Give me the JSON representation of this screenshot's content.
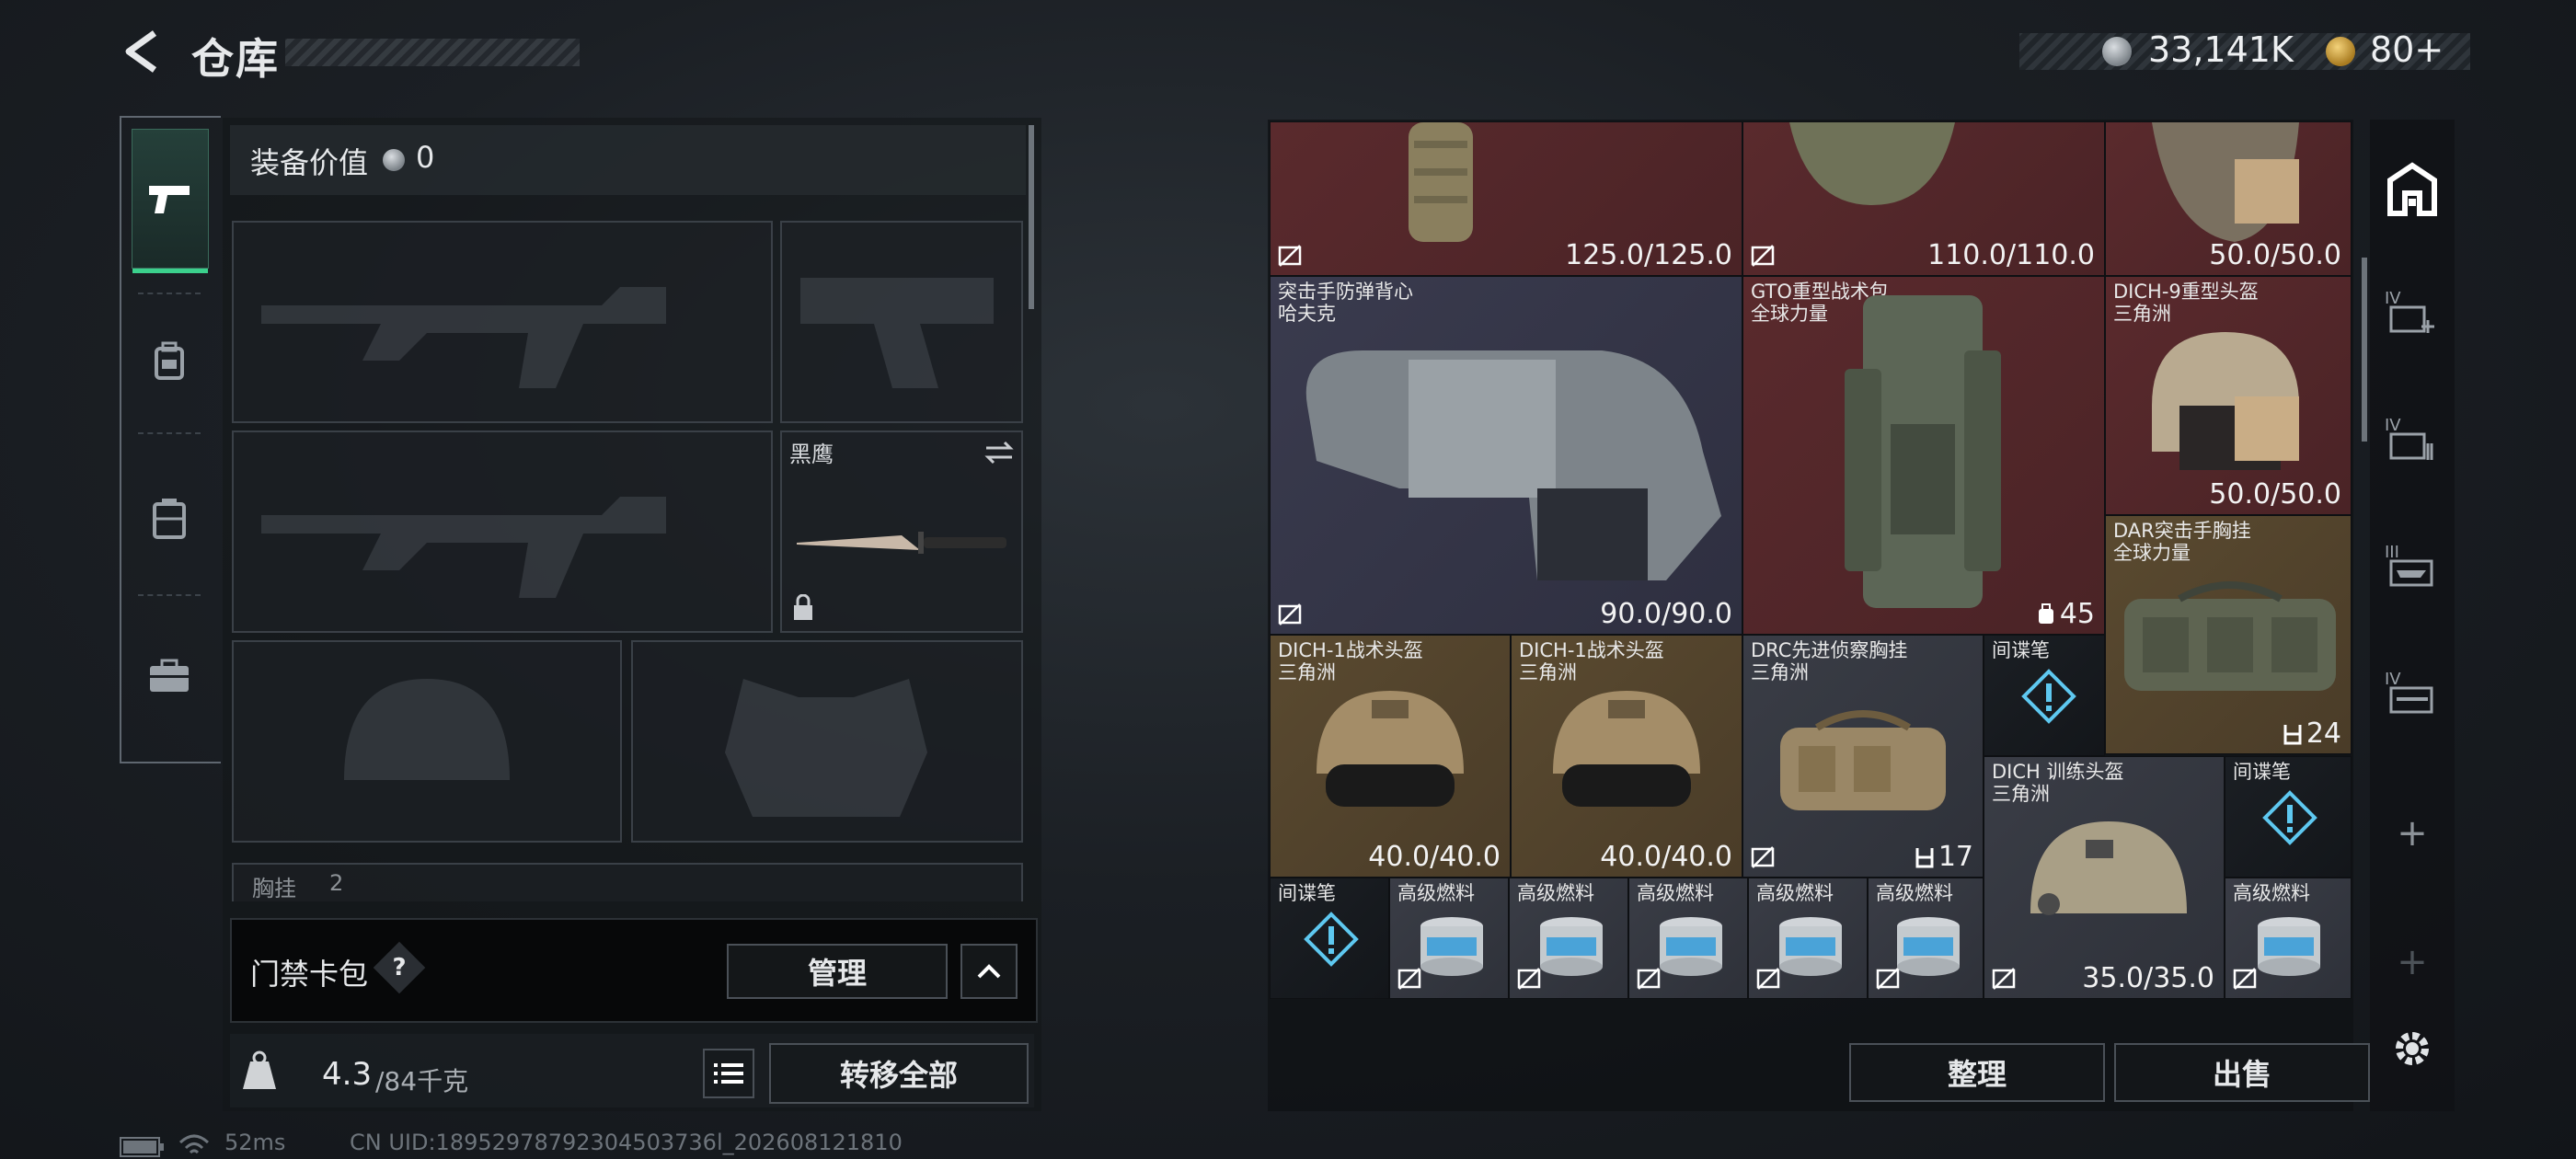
{
  "header": {
    "title": "仓库",
    "currency_silver": "33,141K",
    "currency_gold": "80+"
  },
  "left_tabs": [
    "pistol-tab",
    "backpack-tab",
    "rig-tab",
    "case-tab"
  ],
  "equipment": {
    "value_label": "装备价值",
    "value": "0",
    "knife_label": "黑鹰",
    "partial_label": "胸挂",
    "partial_count": "2"
  },
  "card_pack": {
    "label": "门禁卡包",
    "help": "?",
    "manage": "管理"
  },
  "weight": {
    "current": "4.3",
    "max": "/84千克",
    "transfer_all": "转移全部"
  },
  "inventory": {
    "items": [
      {
        "name_line1": "",
        "name_line2": "",
        "value": "125.0/125.0",
        "color": "red"
      },
      {
        "name_line1": "",
        "name_line2": "",
        "value": "110.0/110.0",
        "color": "red"
      },
      {
        "name_line1": "",
        "name_line2": "",
        "value": "50.0/50.0",
        "color": "red"
      },
      {
        "name_line1": "突击手防弹背心",
        "name_line2": "哈夫克",
        "value": "90.0/90.0",
        "color": "blue"
      },
      {
        "name_line1": "GTO重型战术包",
        "name_line2": "全球力量",
        "value": "45",
        "color": "red"
      },
      {
        "name_line1": "DICH-9重型头盔",
        "name_line2": "三角洲",
        "value": "50.0/50.0",
        "color": "red"
      },
      {
        "name_line1": "DAR突击手胸挂",
        "name_line2": "全球力量",
        "value": "24",
        "color": "gold"
      },
      {
        "name_line1": "DICH-1战术头盔",
        "name_line2": "三角洲",
        "value": "40.0/40.0",
        "color": "gold"
      },
      {
        "name_line1": "DICH-1战术头盔",
        "name_line2": "三角洲",
        "value": "40.0/40.0",
        "color": "gold"
      },
      {
        "name_line1": "DRC先进侦察胸挂",
        "name_line2": "三角洲",
        "value": "17",
        "color": "grey"
      },
      {
        "name_line1": "间谍笔",
        "name_line2": "",
        "value": "",
        "color": "dark"
      },
      {
        "name_line1": "DICH 训练头盔",
        "name_line2": "三角洲",
        "value": "35.0/35.0",
        "color": "grey"
      },
      {
        "name_line1": "间谍笔",
        "name_line2": "",
        "value": "",
        "color": "dark"
      },
      {
        "name_line1": "间谍笔",
        "name_line2": "",
        "value": "",
        "color": "dark"
      },
      {
        "name_line1": "高级燃料",
        "name_line2": "",
        "value": "",
        "color": "grey"
      },
      {
        "name_line1": "高级燃料",
        "name_line2": "",
        "value": "",
        "color": "grey"
      },
      {
        "name_line1": "高级燃料",
        "name_line2": "",
        "value": "",
        "color": "grey"
      },
      {
        "name_line1": "高级燃料",
        "name_line2": "",
        "value": "",
        "color": "grey"
      },
      {
        "name_line1": "高级燃料",
        "name_line2": "",
        "value": "",
        "color": "grey"
      },
      {
        "name_line1": "高级燃料",
        "name_line2": "",
        "value": "",
        "color": "grey"
      }
    ],
    "sort": "整理",
    "sell": "出售"
  },
  "right_bar": {
    "labels": [
      "IV",
      "IV",
      "III",
      "IV"
    ],
    "plus": "+"
  },
  "status": {
    "ping": "52ms",
    "uid": "CN UID:18952978792304503736l_202608121810"
  }
}
